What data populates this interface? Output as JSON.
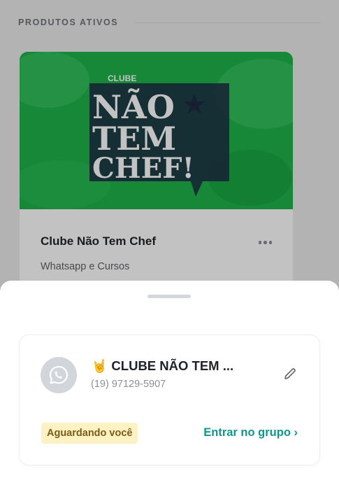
{
  "section": {
    "title": "PRODUTOS ATIVOS"
  },
  "product": {
    "name": "Clube Não Tem Chef",
    "subtitle": "Whatsapp e Cursos",
    "banner": {
      "logo_top": "CLUBE",
      "logo_line1": "NÃO",
      "logo_line2": "TEM",
      "logo_line3": "CHEF!",
      "bg_color": "#1fb34a"
    },
    "more_icon": "more-horizontal-icon"
  },
  "sheet": {
    "group": {
      "emoji": "🤘",
      "title": "CLUBE NÃO TEM ...",
      "phone": "(19) 97129-5907",
      "avatar_icon": "whatsapp-icon",
      "edit_icon": "pencil-icon"
    },
    "status_badge": "Aguardando você",
    "join_label": "Entrar no grupo ›",
    "accent_color": "#11968e",
    "badge_color": "#fdf2c4"
  }
}
